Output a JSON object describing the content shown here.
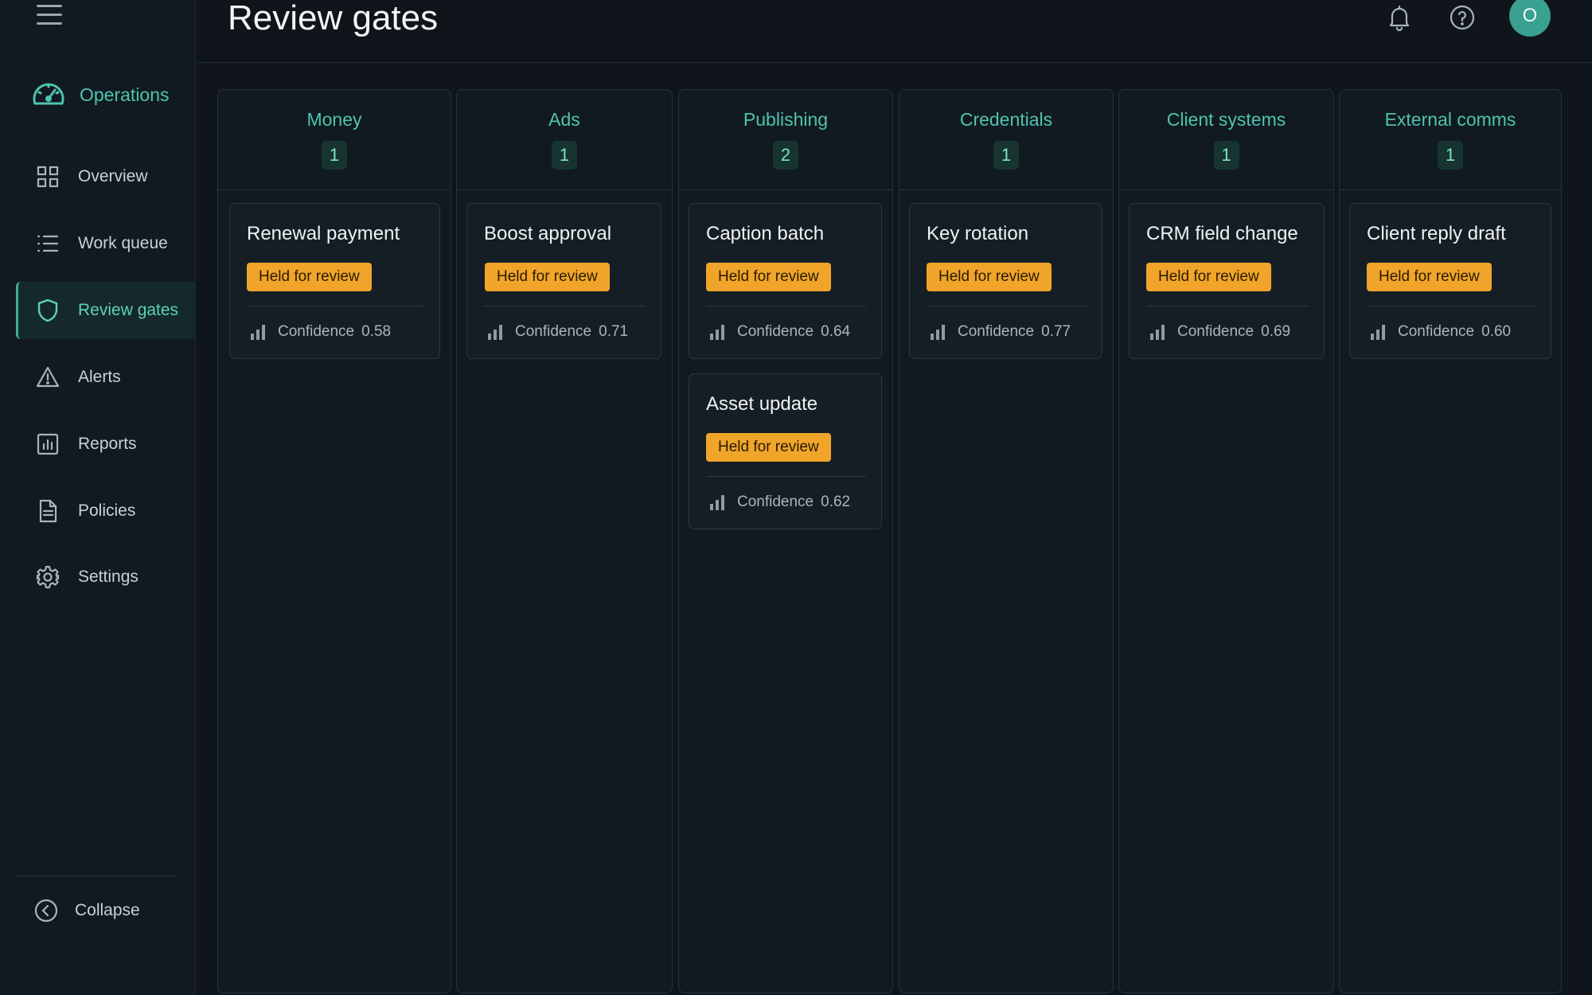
{
  "header": {
    "title": "Review gates",
    "bell_icon": "bell-icon",
    "help_icon": "help-icon",
    "avatar_initial": "O"
  },
  "sidebar": {
    "brand": "Operations",
    "items": [
      {
        "label": "Overview",
        "icon": "grid-icon"
      },
      {
        "label": "Work queue",
        "icon": "list-icon"
      },
      {
        "label": "Review gates",
        "icon": "shield-icon",
        "active": true
      },
      {
        "label": "Alerts",
        "icon": "warning-icon"
      },
      {
        "label": "Reports",
        "icon": "chart-icon"
      },
      {
        "label": "Policies",
        "icon": "document-icon"
      },
      {
        "label": "Settings",
        "icon": "gear-icon"
      }
    ],
    "collapse_label": "Collapse"
  },
  "colors": {
    "accent": "#4fc3b0",
    "badge": "#f0a52a",
    "background": "#0f151a"
  },
  "columns": [
    {
      "title": "Money",
      "count": "1",
      "cards": [
        {
          "title": "Renewal payment",
          "status": "Held for review",
          "confidence_label": "Confidence",
          "confidence": "0.58"
        }
      ]
    },
    {
      "title": "Ads",
      "count": "1",
      "cards": [
        {
          "title": "Boost approval",
          "status": "Held for review",
          "confidence_label": "Confidence",
          "confidence": "0.71"
        }
      ]
    },
    {
      "title": "Publishing",
      "count": "2",
      "cards": [
        {
          "title": "Caption batch",
          "status": "Held for review",
          "confidence_label": "Confidence",
          "confidence": "0.64"
        },
        {
          "title": "Asset update",
          "status": "Held for review",
          "confidence_label": "Confidence",
          "confidence": "0.62"
        }
      ]
    },
    {
      "title": "Credentials",
      "count": "1",
      "cards": [
        {
          "title": "Key rotation",
          "status": "Held for review",
          "confidence_label": "Confidence",
          "confidence": "0.77"
        }
      ]
    },
    {
      "title": "Client systems",
      "count": "1",
      "cards": [
        {
          "title": "CRM field change",
          "status": "Held for review",
          "confidence_label": "Confidence",
          "confidence": "0.69"
        }
      ]
    },
    {
      "title": "External comms",
      "count": "1",
      "cards": [
        {
          "title": "Client reply draft",
          "status": "Held for review",
          "confidence_label": "Confidence",
          "confidence": "0.60"
        }
      ]
    }
  ]
}
